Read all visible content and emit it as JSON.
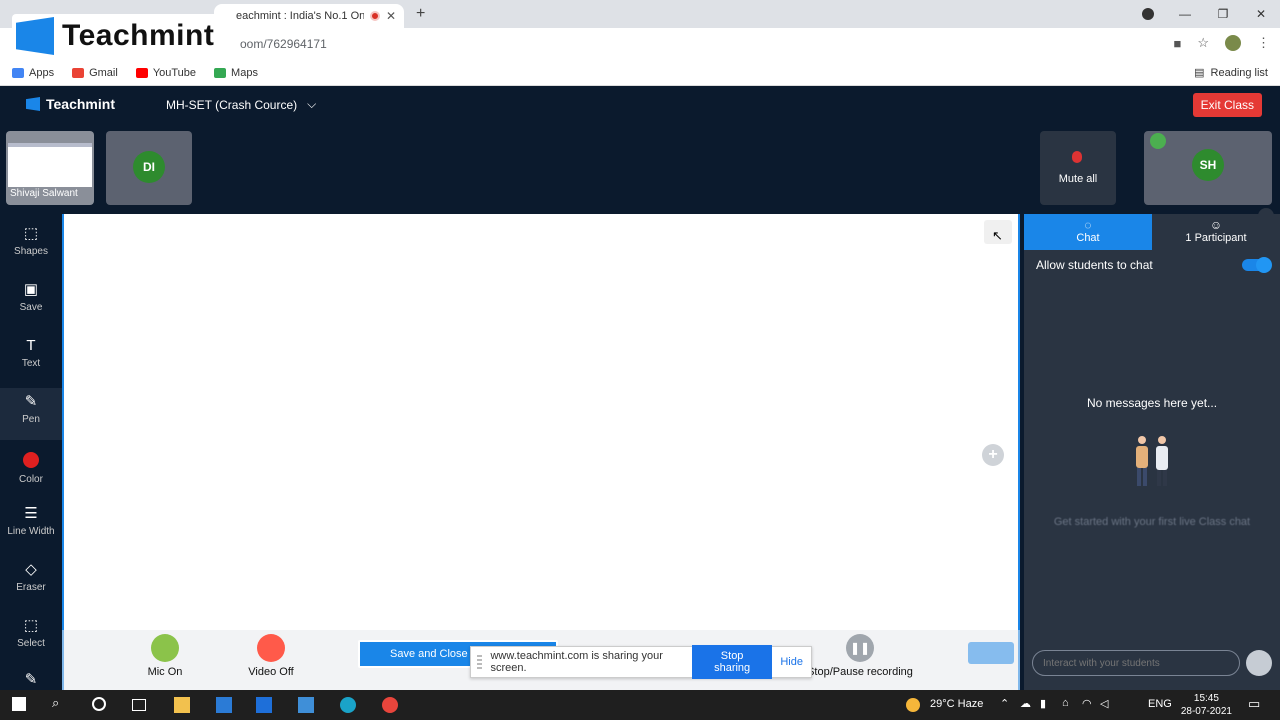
{
  "watermark": {
    "text": "Teachmint"
  },
  "browser": {
    "tab_title": "eachmint : India's No.1 Onli",
    "url": "oom/762964171",
    "bookmarks": [
      "Apps",
      "Gmail",
      "YouTube",
      "Maps"
    ],
    "reading_list": "Reading list"
  },
  "header": {
    "brand": "Teachmint",
    "class_name": "MH-SET (Crash Cource)",
    "exit_label": "Exit Class"
  },
  "participants": {
    "screen_tile_name": "Shivaji Salwant",
    "di_initials": "DI",
    "mute_all": "Mute all",
    "sh_initials": "SH"
  },
  "toolbar": [
    {
      "label": "Shapes",
      "icon": "shapes-icon"
    },
    {
      "label": "Save",
      "icon": "save-icon"
    },
    {
      "label": "Text",
      "icon": "text-icon"
    },
    {
      "label": "Pen",
      "icon": "pen-icon"
    },
    {
      "label": "Color",
      "icon": "color-icon"
    },
    {
      "label": "Line Width",
      "icon": "line-width-icon"
    },
    {
      "label": "Eraser",
      "icon": "eraser-icon"
    },
    {
      "label": "Select",
      "icon": "select-icon"
    }
  ],
  "controls": {
    "mic": "Mic On",
    "video": "Video Off",
    "save_close": "Save and Close",
    "recording": "Stop/Pause recording"
  },
  "share_notice": {
    "message": "www.teachmint.com is sharing your screen.",
    "stop": "Stop sharing",
    "hide": "Hide"
  },
  "chat_panel": {
    "tab_chat": "Chat",
    "tab_participant": "1 Participant",
    "allow_label": "Allow students to chat",
    "allow_on": true,
    "empty_title": "No messages here yet...",
    "empty_sub": "Get started with your first live Class chat",
    "input_placeholder": "Interact with your students"
  },
  "taskbar": {
    "weather": "29°C  Haze",
    "lang": "ENG",
    "time": "15:45",
    "date": "28-07-2021"
  },
  "colors": {
    "accent": "#1a86e8",
    "danger": "#e53935",
    "dark_bg": "#0b1a2d",
    "panel_bg": "#2a3442"
  }
}
